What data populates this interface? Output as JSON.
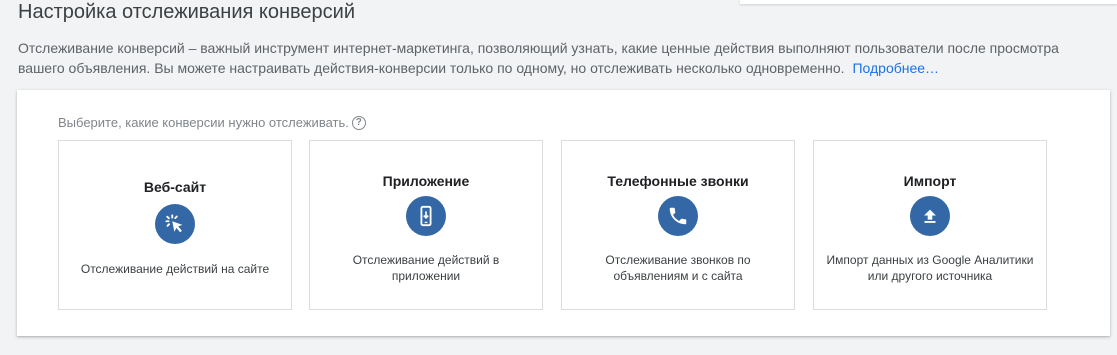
{
  "header": {
    "title": "Настройка отслеживания конверсий",
    "description": "Отслеживание конверсий – важный инструмент интернет-маркетинга, позволяющий узнать, какие ценные действия выполняют пользователи после просмотра вашего объявления. Вы можете настраивать действия-конверсии только по одному, но отслеживать несколько одновременно.",
    "learn_more": "Подробнее…"
  },
  "card": {
    "prompt": "Выберите, какие конверсии нужно отслеживать.",
    "help_icon": "?",
    "options": [
      {
        "title": "Веб-сайт",
        "icon": "cursor-click-icon",
        "description": "Отслеживание действий на сайте"
      },
      {
        "title": "Приложение",
        "icon": "mobile-app-icon",
        "description": "Отслеживание действий в приложении"
      },
      {
        "title": "Телефонные звонки",
        "icon": "phone-icon",
        "description": "Отслеживание звонков по объявлениям и с сайта"
      },
      {
        "title": "Импорт",
        "icon": "upload-icon",
        "description": "Импорт данных из Google Аналитики или другого источника"
      }
    ]
  },
  "colors": {
    "accent": "#1a73e8",
    "icon_bg": "#3367a6"
  }
}
